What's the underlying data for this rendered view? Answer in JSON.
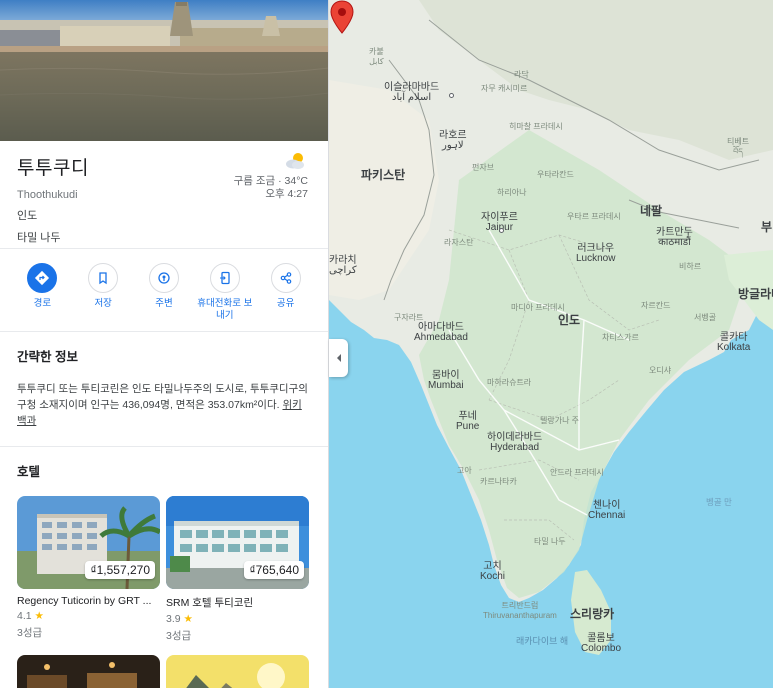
{
  "place": {
    "title": "투투쿠디",
    "subtitle": "Thoothukudi",
    "country": "인도",
    "state": "타밀 나두"
  },
  "weather": {
    "condition_temp": "구름 조금 · 34°C",
    "time": "오후 4:27",
    "icon": "partly-cloudy-icon"
  },
  "actions": [
    {
      "label": "경로",
      "icon": "directions-icon"
    },
    {
      "label": "저장",
      "icon": "bookmark-icon"
    },
    {
      "label": "주변",
      "icon": "nearby-icon"
    },
    {
      "label": "휴대전화로 보내기",
      "icon": "send-to-phone-icon"
    },
    {
      "label": "공유",
      "icon": "share-icon"
    }
  ],
  "overview": {
    "title": "간략한 정보",
    "text": "투투쿠디 또는 투티코린은 인도 타밀나두주의 도시로, 투투쿠디구의 구청 소재지이며 인구는 436,094명, 면적은 353.07km²이다.",
    "link": "위키백과"
  },
  "hotels": {
    "title": "호텔",
    "items": [
      {
        "name": "Regency Tuticorin by GRT ...",
        "price": "₫1,557,270",
        "rating": "4.1",
        "star": "★",
        "class": "3성급"
      },
      {
        "name": "SRM 호텔 투티코린",
        "price": "₫765,640",
        "rating": "3.9",
        "star": "★",
        "class": "3성급"
      }
    ]
  },
  "map": {
    "labels": {
      "kabul": "카불",
      "kabul_local": "کابل",
      "islamabad": "이슬라마바드",
      "islamabad_local": "اسلام آباد",
      "lahore": "라호르",
      "lahore_local": "لاہور",
      "pakistan": "파키스탄",
      "jammu": "자무 캐시미르",
      "ladakh": "라닥",
      "himachal": "히마찰 프라데시",
      "punjab": "펀자브",
      "haryana": "하리아나",
      "uttarakhand": "우타라칸드",
      "uttar_pradesh": "우타르 프라데시",
      "rajasthan": "라자스탄",
      "jaipur": "자이푸르",
      "jaipur_en": "Jaipur",
      "nepal": "네팔",
      "kathmandu": "카트만두",
      "kathmandu_local": "काठमाडौं",
      "tibet": "티베트",
      "tibet_local": "བོད",
      "bhutan_partial": "부",
      "lucknow": "러크나우",
      "lucknow_en": "Lucknow",
      "bihar": "비하르",
      "karachi": "카라치",
      "karachi_local": "كراچی",
      "gujarat": "구자라트",
      "ahmedabad": "아마다바드",
      "ahmedabad_en": "Ahmedabad",
      "madhya_pradesh": "마디아 프라데시",
      "india": "인도",
      "jharkhand": "자르칸드",
      "west_bengal": "서벵골",
      "chhattisgarh": "차티스가르",
      "odisha": "오디샤",
      "bangladesh": "방글라데",
      "kolkata": "콜카타",
      "kolkata_en": "Kolkata",
      "mumbai": "뭄바이",
      "mumbai_en": "Mumbai",
      "maharashtra": "마하라슈트라",
      "pune": "푸네",
      "pune_en": "Pune",
      "telangana": "텔랑가나 주",
      "hyderabad": "하이데라바드",
      "hyderabad_en": "Hyderabad",
      "goa": "고아",
      "andhra": "안드라 프라데시",
      "karnataka": "카르나타카",
      "chennai": "첸나이",
      "chennai_en": "Chennai",
      "tamil_nadu": "타밀 나두",
      "bay_of_bengal": "벵골 만",
      "kochi": "고치",
      "kochi_en": "Kochi",
      "trivandrum": "트리반드럼",
      "trivandrum_en": "Thiruvananthapuram",
      "sri_lanka": "스리랑카",
      "laccadive_sea": "래카다이브 해",
      "colombo": "콜롬보",
      "colombo_en": "Colombo"
    }
  }
}
